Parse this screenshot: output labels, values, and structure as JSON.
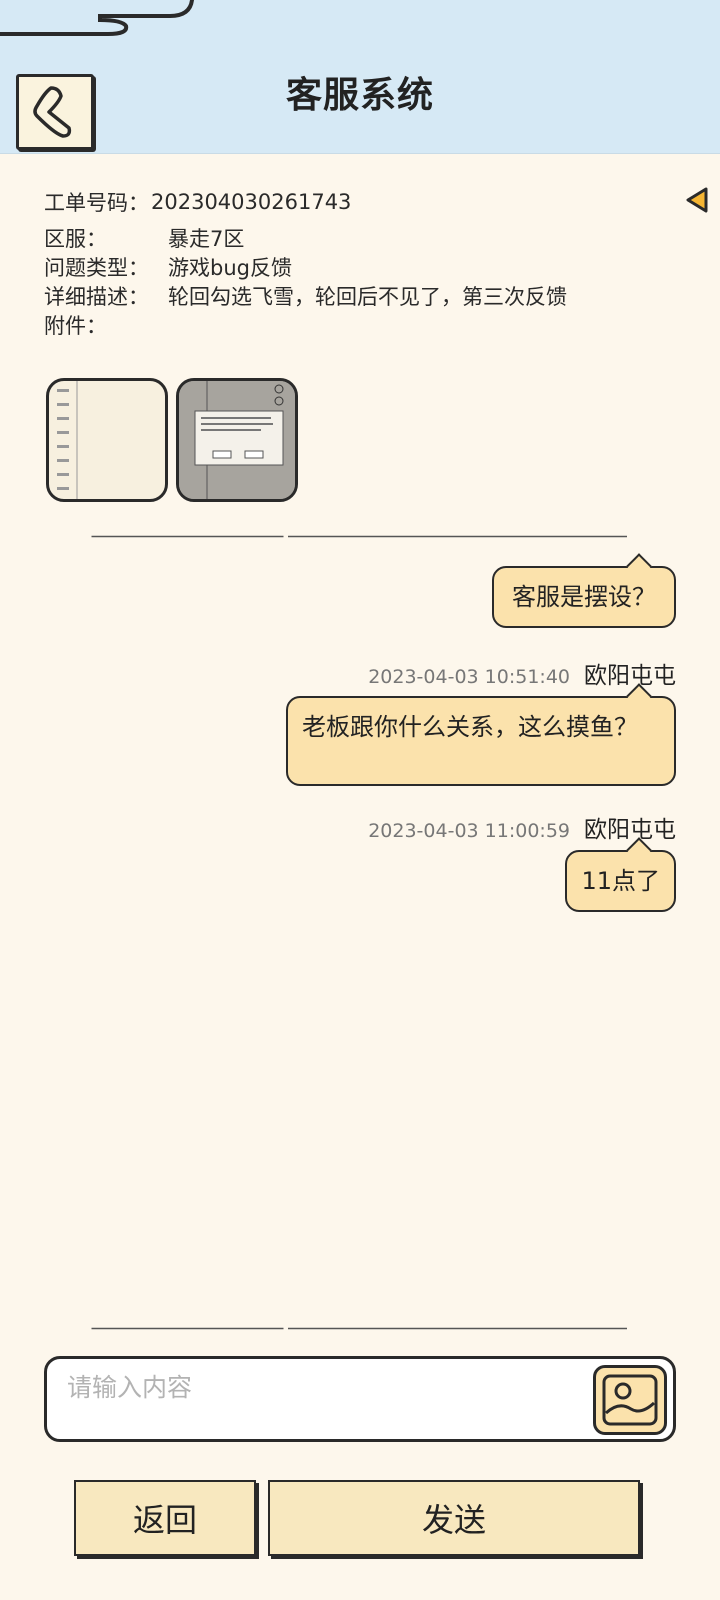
{
  "header": {
    "title": "客服系统",
    "back_icon": "chevron-left-icon"
  },
  "ticket": {
    "number_label": "工单号码：",
    "number_value": "202304030261743",
    "server_label": "区服：",
    "server_value": "暴走7区",
    "type_label": "问题类型：",
    "type_value": "游戏bug反馈",
    "desc_label": "详细描述：",
    "desc_value": "轮回勾选飞雪，轮回后不见了，第三次反馈",
    "attach_label": "附件："
  },
  "attachments": [
    {
      "icon": "screenshot-thumbnail-menu"
    },
    {
      "icon": "screenshot-thumbnail-dialog"
    }
  ],
  "messages": [
    {
      "text": "客服是摆设？",
      "time": "",
      "sender": ""
    },
    {
      "time": "2023-04-03 10:51:40",
      "sender": "欧阳屯屯",
      "text": "老板跟你什么关系，这么摸鱼？"
    },
    {
      "time": "2023-04-03 11:00:59",
      "sender": "欧阳屯屯",
      "text": "11点了"
    }
  ],
  "input": {
    "placeholder": "请输入内容",
    "image_icon": "image-icon"
  },
  "buttons": {
    "back_label": "返回",
    "send_label": "发送"
  },
  "colors": {
    "header_bg": "#d6e9f5",
    "page_bg": "#fdf7ec",
    "bubble_bg": "#fbe2ac",
    "button_bg": "#f8e8bf",
    "accent": "#f5b533"
  }
}
